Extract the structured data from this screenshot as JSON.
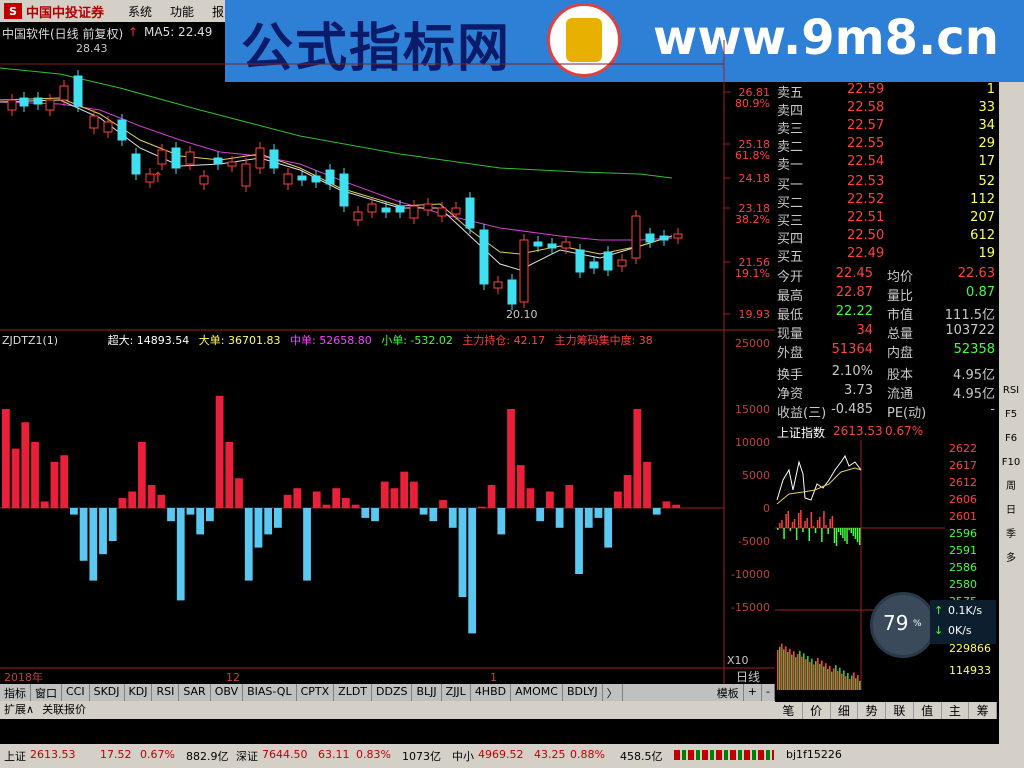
{
  "menubar": {
    "logo_text": "中国中投证券",
    "items": [
      "系统",
      "功能",
      "报"
    ]
  },
  "banner": {
    "title": "公式指标网",
    "url": "www.9m8.cn"
  },
  "chart": {
    "title": "中国软件(日线 前复权)",
    "ma5_label": "MA5: 22.49",
    "high_marker": "28.43",
    "low_marker": "20.10",
    "price_ticks": [
      {
        "price": "26.81",
        "pct": "80.9%"
      },
      {
        "price": "25.18",
        "pct": "61.8%"
      },
      {
        "price": "24.18",
        "pct": ""
      },
      {
        "price": "23.18",
        "pct": "38.2%"
      },
      {
        "price": "21.56",
        "pct": "19.1%"
      },
      {
        "price": "19.93",
        "pct": ""
      }
    ],
    "x_labels": [
      "2018年",
      "12",
      "1"
    ],
    "x_unit": "X10",
    "period": "日线"
  },
  "chart_data": {
    "type": "bar",
    "title": "ZJDTZ1(1)",
    "series_labels": {
      "super": "超大: 14893.54",
      "big": "大单: 36701.83",
      "mid": "中单: 52658.80",
      "small": "小单: -532.02",
      "main_hold": "主力持仓: 42.17",
      "main_conc": "主力筹码集中度: 38"
    },
    "y_ticks": [
      "25000",
      "15000",
      "10000",
      "5000",
      "0",
      "-5000",
      "-10000",
      "-15000"
    ],
    "ylim": [
      -24000,
      26000
    ],
    "values": [
      15000,
      9000,
      13000,
      10000,
      1000,
      7000,
      8000,
      -1000,
      -8000,
      -11000,
      -7000,
      -5000,
      1500,
      2500,
      10000,
      3500,
      2000,
      -2000,
      -14000,
      -1000,
      -4000,
      -2000,
      17000,
      10000,
      4500,
      -11000,
      -6000,
      -4000,
      -3000,
      2000,
      3000,
      -11000,
      2500,
      500,
      3000,
      1500,
      500,
      -1500,
      -2000,
      4000,
      3000,
      5500,
      4000,
      -1000,
      -2000,
      1200,
      -3000,
      -13500,
      -19000,
      200,
      3500,
      -4000,
      15000,
      6500,
      3000,
      -2000,
      2500,
      -3000,
      3500,
      -10000,
      -3000,
      -1500,
      -6000,
      2500,
      5000,
      15000,
      7000,
      -1000,
      1000,
      500
    ],
    "color_up": "#e8203a",
    "color_down": "#5ac8f0"
  },
  "orderbook": {
    "sell": [
      {
        "label": "卖五",
        "price": "22.59",
        "qty": "1"
      },
      {
        "label": "卖四",
        "price": "22.58",
        "qty": "33"
      },
      {
        "label": "卖三",
        "price": "22.57",
        "qty": "34"
      },
      {
        "label": "卖二",
        "price": "22.55",
        "qty": "29"
      },
      {
        "label": "卖一",
        "price": "22.54",
        "qty": "17"
      }
    ],
    "buy": [
      {
        "label": "买一",
        "price": "22.53",
        "qty": "52"
      },
      {
        "label": "买二",
        "price": "22.52",
        "qty": "112"
      },
      {
        "label": "买三",
        "price": "22.51",
        "qty": "207"
      },
      {
        "label": "买四",
        "price": "22.50",
        "qty": "612"
      },
      {
        "label": "买五",
        "price": "22.49",
        "qty": "19"
      }
    ]
  },
  "stats": [
    {
      "l1": "今开",
      "v1": "22.45",
      "c1": "#ff4040",
      "l2": "均价",
      "v2": "22.63",
      "c2": "#ff4040"
    },
    {
      "l1": "最高",
      "v1": "22.87",
      "c1": "#ff4040",
      "l2": "量比",
      "v2": "0.87",
      "c2": "#40ff40"
    },
    {
      "l1": "最低",
      "v1": "22.22",
      "c1": "#40ff40",
      "l2": "市值",
      "v2": "111.5亿",
      "c2": "#c8c8c8"
    },
    {
      "l1": "现量",
      "v1": "34",
      "c1": "#ff4040",
      "l2": "总量",
      "v2": "103722",
      "c2": "#c8c8c8"
    },
    {
      "l1": "外盘",
      "v1": "51364",
      "c1": "#ff4040",
      "l2": "内盘",
      "v2": "52358",
      "c2": "#40ff40"
    },
    {
      "l1": "换手",
      "v1": "2.10%",
      "c1": "#c8c8c8",
      "l2": "股本",
      "v2": "4.95亿",
      "c2": "#c8c8c8"
    },
    {
      "l1": "净资",
      "v1": "3.73",
      "c1": "#c8c8c8",
      "l2": "流通",
      "v2": "4.95亿",
      "c2": "#c8c8c8"
    },
    {
      "l1": "收益(三)",
      "v1": "-0.485",
      "c1": "#c8c8c8",
      "l2": "PE(动)",
      "v2": "-",
      "c2": "#c8c8c8"
    }
  ],
  "index_mini": {
    "title": "上证指数",
    "value": "2613.53",
    "pct": "0.67%",
    "ticks": [
      "2622",
      "2617",
      "2612",
      "2606",
      "2601",
      "2596",
      "2591",
      "2586",
      "2580",
      "2575",
      "2"
    ],
    "vol_ticks": [
      "229866",
      "114933"
    ]
  },
  "gauge": {
    "value": "79",
    "unit": "%",
    "up": "0.1K/s",
    "down": "0K/s"
  },
  "rtabs": [
    "笔",
    "价",
    "细",
    "势",
    "联",
    "值",
    "主",
    "筹"
  ],
  "tabs": [
    "指标",
    "窗口",
    "CCI",
    "SKDJ",
    "KDJ",
    "RSI",
    "SAR",
    "OBV",
    "BIAS-QL",
    "CPTX",
    "ZLDT",
    "DDZS",
    "BLJJ",
    "ZJJL",
    "4HBD",
    "AMOMC",
    "BDLYJ",
    "〉",
    "模板",
    "+",
    "-"
  ],
  "tabs2": [
    "扩展∧",
    "关联报价"
  ],
  "statusbar": {
    "sh_label": "上证",
    "sh_val": "2613.53",
    "sh_chg": "17.52",
    "sh_pct": "0.67%",
    "sh_amt": "882.9亿",
    "sz_label": "深证",
    "sz_val": "7644.50",
    "sz_chg": "63.11",
    "sz_pct": "0.83%",
    "sz_amt": "1073亿",
    "zx_label": "中小",
    "zx_val": "4969.52",
    "zx_chg": "43.25",
    "zx_pct": "0.88%",
    "zx_amt": "458.5亿",
    "user": "bj1f15226"
  },
  "sidebar_buttons": [
    "RSI",
    "F5",
    "F6",
    "F10",
    "周",
    "日",
    "季",
    "多"
  ]
}
